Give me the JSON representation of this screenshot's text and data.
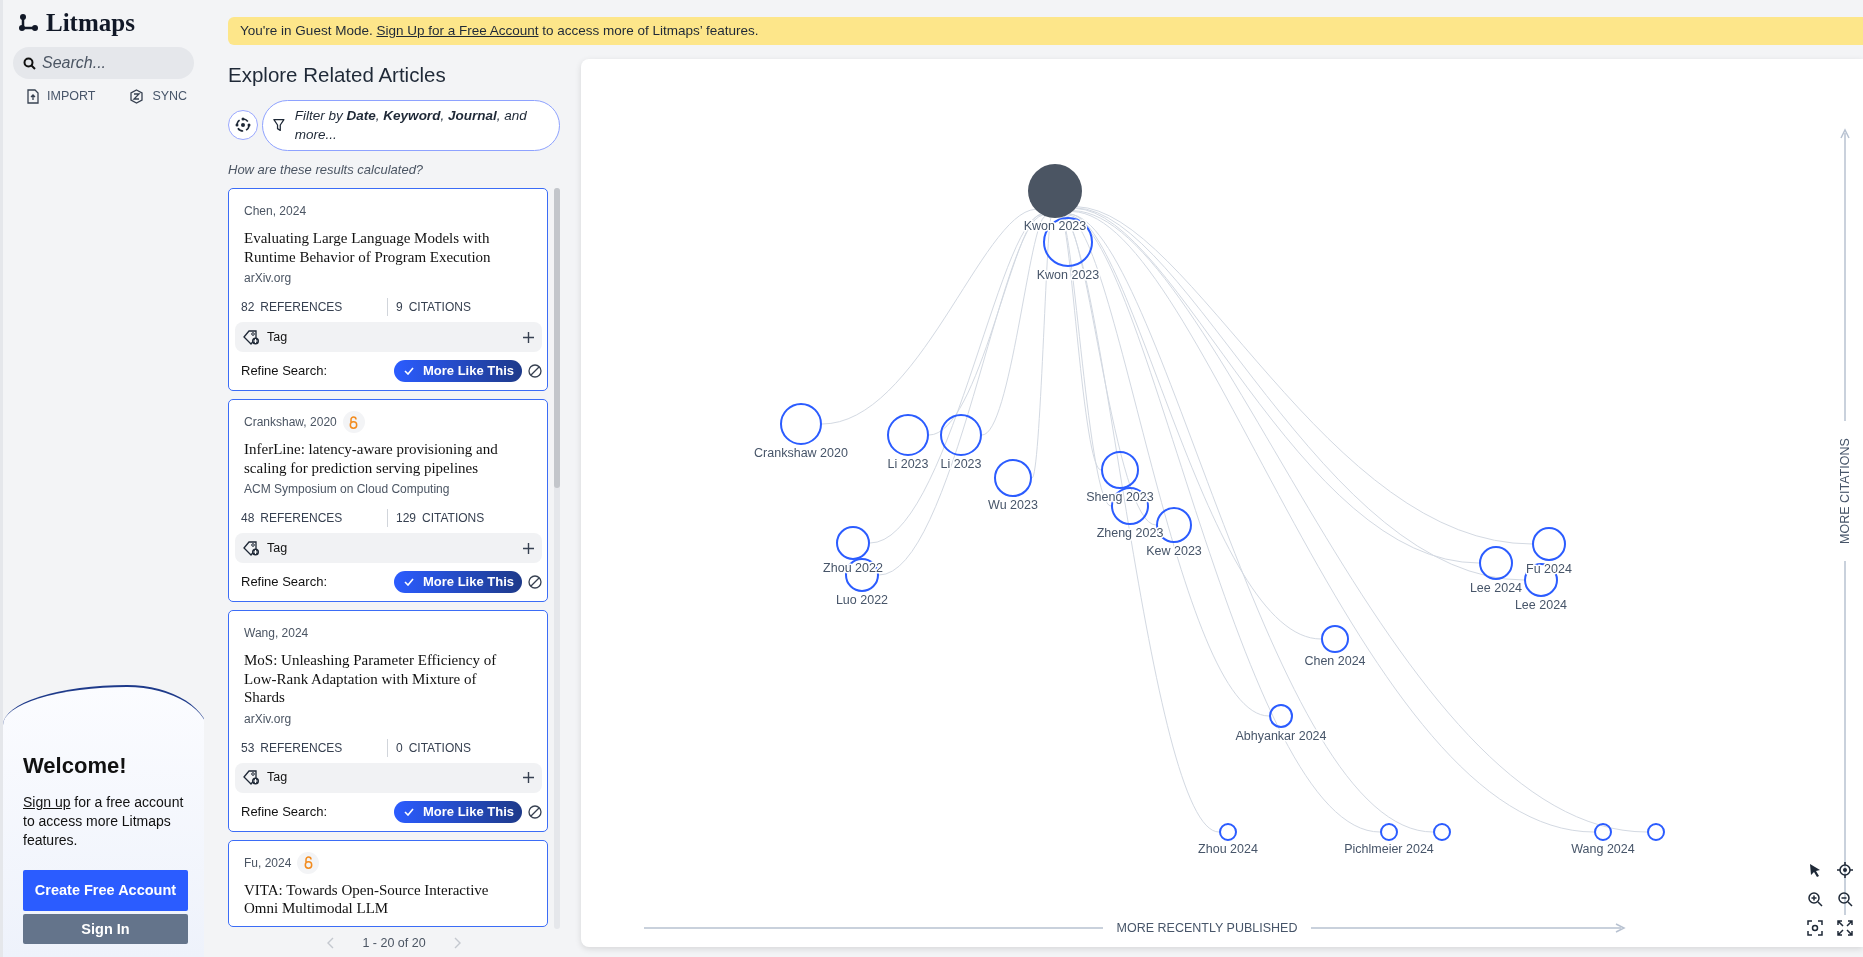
{
  "sidebar": {
    "logo": "Litmaps",
    "search": {
      "placeholder": "Search..."
    },
    "actions": [
      {
        "label": "IMPORT",
        "kind": "import"
      },
      {
        "label": "SYNC",
        "kind": "sync"
      }
    ],
    "welcome": {
      "title": "Welcome!",
      "link": "Sign up",
      "text": " for a free account to access more Litmaps features.",
      "buttons": [
        {
          "label": "Create Free Account",
          "kind": "primary"
        },
        {
          "label": "Sign In",
          "kind": "secondary"
        }
      ]
    }
  },
  "banner": {
    "before": "You're in Guest Mode. ",
    "link": "Sign Up for a Free Account",
    "after": " to access more of Litmaps’ features."
  },
  "articles": {
    "title": "Explore Related Articles",
    "filter": "Filter by **Date**, **Keyword**, **Journal**, and more...",
    "help": "How are these results calculated?",
    "cards": [
      {
        "author": "Chen, 2024",
        "open_access": false,
        "title": "Evaluating Large Language Models with Runtime Behavior of Program Execution",
        "journal": "arXiv.org",
        "references": "82",
        "references_label": "REFERENCES",
        "citations": "9",
        "citations_label": "CITATIONS",
        "tag": "Tag",
        "refine_label": "Refine Search:",
        "action": "More Like This"
      },
      {
        "author": "Crankshaw, 2020",
        "open_access": true,
        "title": "InferLine: latency-aware provisioning and scaling for prediction serving pipelines",
        "journal": "ACM Symposium on Cloud Computing",
        "references": "48",
        "references_label": "REFERENCES",
        "citations": "129",
        "citations_label": "CITATIONS",
        "tag": "Tag",
        "refine_label": "Refine Search:",
        "action": "More Like This"
      },
      {
        "author": "Wang, 2024",
        "open_access": false,
        "title": "MoS: Unleashing Parameter Efficiency of Low-Rank Adaptation with Mixture of Shards",
        "journal": "arXiv.org",
        "references": "53",
        "references_label": "REFERENCES",
        "citations": "0",
        "citations_label": "CITATIONS",
        "tag": "Tag",
        "refine_label": "Refine Search:",
        "action": "More Like This"
      },
      {
        "author": "Fu, 2024",
        "open_access": true,
        "title": "VITA: Towards Open-Source Interactive Omni Multimodal LLM"
      }
    ],
    "pagination": "1 - 20 of 20"
  },
  "graph": {
    "x_axis": "MORE RECENTLY PUBLISHED",
    "y_axis": "MORE CITATIONS",
    "nodes": [
      {
        "label": "Kwon 2023",
        "kind": "seed"
      },
      {
        "label": "Kwon 2023",
        "kind": "related"
      },
      {
        "label": "Crankshaw 2020",
        "kind": "related"
      },
      {
        "label": "Li 2023",
        "kind": "related"
      },
      {
        "label": "Li 2023",
        "kind": "related"
      },
      {
        "label": "Wu 2023",
        "kind": "related"
      },
      {
        "label": "Sheng 2023",
        "kind": "related"
      },
      {
        "label": "Zheng 2023",
        "kind": "related"
      },
      {
        "label": "Kew 2023",
        "kind": "related"
      },
      {
        "label": "Zhou 2022",
        "kind": "related"
      },
      {
        "label": "Luo 2022",
        "kind": "related"
      },
      {
        "label": "Lee 2024",
        "kind": "related"
      },
      {
        "label": "Fu 2024",
        "kind": "related"
      },
      {
        "label": "Lee 2024",
        "kind": "related"
      },
      {
        "label": "Chen 2024",
        "kind": "related"
      },
      {
        "label": "Abhyankar 2024",
        "kind": "related"
      },
      {
        "label": "Zhou 2024",
        "kind": "related"
      },
      {
        "label": "Pichlmeier 2024",
        "kind": "related"
      },
      {
        "kind": "related"
      },
      {
        "label": "Wang 2024",
        "kind": "related"
      },
      {
        "kind": "related"
      }
    ]
  }
}
